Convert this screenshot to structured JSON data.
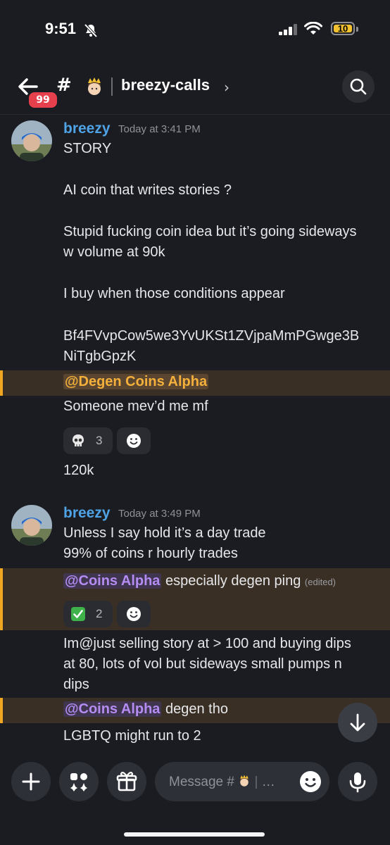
{
  "status_bar": {
    "time": "9:51",
    "battery": "10"
  },
  "header": {
    "unread_badge": "99",
    "hash": "#",
    "channel_name": "breezy-calls",
    "chevron": "›"
  },
  "messages": [
    {
      "author": "breezy",
      "timestamp": "Today at 3:41 PM",
      "lines": [
        "STORY",
        "AI coin that writes stories ?",
        "Stupid fucking coin idea but it’s going sideways",
        "w volume at 90k",
        "I buy when those conditions appear",
        "Bf4FVvpCow5we3YvUKSt1ZVjpaMmPGwge3B",
        "NiTgbGpzK"
      ],
      "mention": "@Degen Coins Alpha",
      "followups": [
        "Someone mev’d me mf"
      ],
      "reaction": {
        "emoji": "skull",
        "count": "3"
      },
      "after": "120k"
    },
    {
      "author": "breezy",
      "timestamp": "Today at 3:49 PM",
      "lines": [
        "Unless I say hold it’s a day trade",
        "99% of coins r hourly trades"
      ],
      "mention1": {
        "tag": "@Coins Alpha",
        "text": " especially degen ping",
        "edited": "(edited)"
      },
      "reaction": {
        "emoji": "check",
        "count": "2"
      },
      "lines2": [
        "Im@just selling story at > 100 and buying dips",
        "at 80, lots of vol but sideways small pumps n",
        "dips"
      ],
      "mention2": {
        "tag": "@Coins Alpha",
        "text": " degen tho"
      },
      "last": "LGBTQ might run to 2"
    }
  ],
  "composer": {
    "placeholder": "Message #",
    "ellipsis": "…"
  },
  "colors": {
    "background": "#1b1c21",
    "username": "#4ea3e6",
    "mention_highlight": "#3a2f24",
    "mention_bar": "#f0a823",
    "badge": "#e5404b"
  }
}
